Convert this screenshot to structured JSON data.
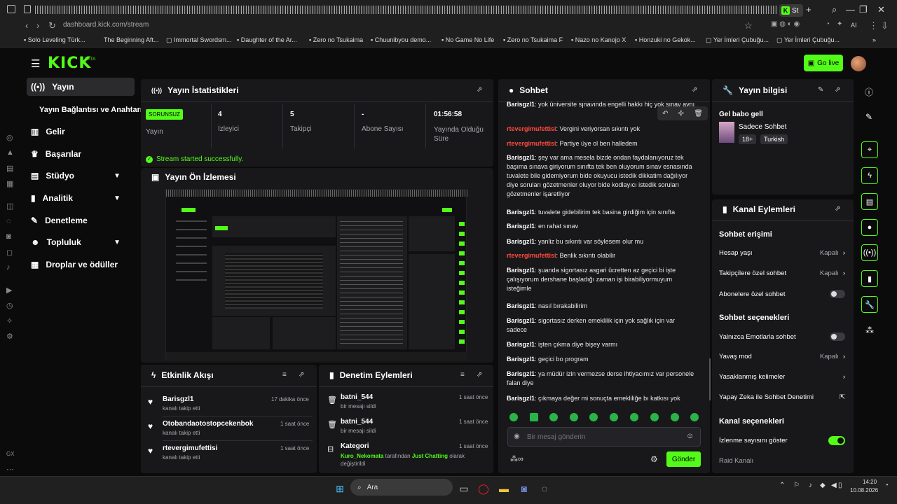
{
  "browser": {
    "active_tab_label": "St",
    "url": "dashboard.kick.com/stream",
    "bookmarks": [
      "Solo Leveling Türk...",
      "The Beginning Aft...",
      "Immortal Swordsm...",
      "Daughter of the Ar...",
      "Zero no Tsukaima",
      "Chuunibyou demo...",
      "No Game No Life",
      "Zero no Tsukaima F",
      "Nazo no Kanojo X",
      "Honzuki no Gekok...",
      "Yer İmleri Çubuğu...",
      "Yer İmleri Çubuğu..."
    ],
    "ai_label": "AI"
  },
  "app": {
    "logo": "KICK",
    "logo_beta": "BETA",
    "go_live": "Go live"
  },
  "sidebar": {
    "items": [
      {
        "label": "Yayın",
        "icon": "broadcast-icon"
      },
      {
        "label": "Yayın Bağlantısı ve Anahtarı"
      },
      {
        "label": "Gelir",
        "icon": "chart-icon"
      },
      {
        "label": "Başarılar",
        "icon": "trophy-icon"
      },
      {
        "label": "Stüdyo",
        "icon": "studio-icon"
      },
      {
        "label": "Analitik",
        "icon": "bar-chart-icon"
      },
      {
        "label": "Denetleme",
        "icon": "wrench-icon"
      },
      {
        "label": "Topluluk",
        "icon": "people-icon"
      },
      {
        "label": "Droplar ve ödüller",
        "icon": "gift-icon"
      }
    ]
  },
  "stats": {
    "title": "Yayın İstatistikleri",
    "status_badge": "SORUNSUZ",
    "status_label": "Yayın",
    "viewers_value": "4",
    "viewers_label": "İzleyici",
    "followers_value": "5",
    "followers_label": "Takipçi",
    "subs_value": "-",
    "subs_label": "Abone Sayısı",
    "uptime_value": "01:56:58",
    "uptime_label": "Yayında Olduğu Süre",
    "success_msg": "Stream started successfully."
  },
  "preview": {
    "title": "Yayın Ön İzlemesi"
  },
  "activity": {
    "title": "Etkinlik Akışı",
    "items": [
      {
        "user": "Barisgzl1",
        "action": "kanalı takip etti",
        "time": "17 dakika önce"
      },
      {
        "user": "Otobandaotostopcekenbok",
        "action": "kanalı takip etti",
        "time": "1 saat önce"
      },
      {
        "user": "rtevergimufettisi",
        "action": "kanalı takip etti",
        "time": "1 saat önce"
      }
    ]
  },
  "modactions": {
    "title": "Denetim Eylemleri",
    "items": [
      {
        "user": "batni_544",
        "action": "bir mesajı sildi",
        "time": "1 saat önce"
      },
      {
        "user": "batni_544",
        "action": "bir mesajı sildi",
        "time": "1 saat önce"
      }
    ],
    "category": {
      "title": "Kategori",
      "time": "1 saat önce",
      "actor": "Kuro_Nekomata",
      "by": "tarafından",
      "game": "Just Chatting",
      "rest1": "olarak",
      "rest2": "değiştirildi"
    }
  },
  "chat": {
    "title": "Sohbet",
    "messages": [
      {
        "user": "Barisgzl1",
        "text": "yok üniversite sınavında engelli hakkı hiç yok sınav aynı",
        "color": "#ffffff"
      },
      {
        "user": "rtevergimufettisi",
        "text": "Vergini veriyorsan sıkıntı yok",
        "color": "#ff4a3d"
      },
      {
        "user": "rtevergimufettisi",
        "text": "Partiye üye ol ben halledem",
        "color": "#ff4a3d"
      },
      {
        "user": "Barisgzl1",
        "text": "şey var ama mesela bizde ondan faydalanıyoruz tek başıma sınava giriyorum sınıfta tek ben oluyorum sınav esnasında tuvalete bile gidemiyorum bide okuyucu istedik dikkatim dağılıyor diye soruları gözetmenler oluyor bide kodlayıcı istedik soruları gözetmenler işaretliyor",
        "color": "#ffffff"
      },
      {
        "user": "Barisgzl1",
        "text": "tuvalete gidebilirim tek basina girdiğim için sınıfta",
        "color": "#ffffff"
      },
      {
        "user": "Barisgzl1",
        "text": "en rahat sınav",
        "color": "#ffffff"
      },
      {
        "user": "Barisgzl1",
        "text": "yanliz bu sıkıntı var söylesem olur mu",
        "color": "#ffffff"
      },
      {
        "user": "rtevergimufettisi",
        "text": "Benlik sıkıntı olabilir",
        "color": "#ff4a3d"
      },
      {
        "user": "Barisgzl1",
        "text": "şuanda sigortasız asgari ücretten az geçici bi işte çalışıyorum dershane başladığı zaman işi birabiliyormuyum isteğimle",
        "color": "#ffffff"
      },
      {
        "user": "Barisgzl1",
        "text": "nasıl bırakabilirim",
        "color": "#ffffff"
      },
      {
        "user": "Barisgzl1",
        "text": "sigortasız derken emeklilik için yok sağlık için var sadece",
        "color": "#ffffff"
      },
      {
        "user": "Barisgzl1",
        "text": "işten çıkma diye bişey varmı",
        "color": "#ffffff"
      },
      {
        "user": "Barisgzl1",
        "text": "geçici bo program",
        "color": "#ffffff"
      },
      {
        "user": "Barisgzl1",
        "text": "ya müdür izin vermezse derse ihtiyacımız var personele falan diye",
        "color": "#ffffff"
      },
      {
        "user": "Barisgzl1",
        "text": "çıkmaya değer mi sonuçta emekliliğe bı katkısı yok",
        "color": "#ffffff"
      }
    ],
    "placeholder": "Bir mesaj gönderin",
    "send": "Gönder"
  },
  "info": {
    "title": "Yayın bilgisi",
    "stream_title": "Gel babo gell",
    "category": "Sadece Sohbet",
    "tags": [
      "18+",
      "Turkish"
    ]
  },
  "channel": {
    "title": "Kanal Eylemleri",
    "chat_access": "Sohbet erişimi",
    "account_age": "Hesap yaşı",
    "account_age_val": "Kapalı",
    "followers_chat": "Takipçilere özel sohbet",
    "followers_chat_val": "Kapalı",
    "subs_chat": "Abonelere özel sohbet",
    "chat_options": "Sohbet seçenekleri",
    "emote_only": "Yalnızca Emotlarla sohbet",
    "slow_mode": "Yavaş mod",
    "slow_mode_val": "Kapalı",
    "banned_words": "Yasaklanmış kelimeler",
    "ai_mod": "Yapay Zeka ile Sohbet Denetimi",
    "channel_options": "Kanal seçenekleri",
    "show_viewers": "İzlenme sayısını göster",
    "raid": "Raid Kanalı"
  },
  "taskbar": {
    "search": "Ara",
    "time": "14:20",
    "date": "10.08.2026"
  }
}
